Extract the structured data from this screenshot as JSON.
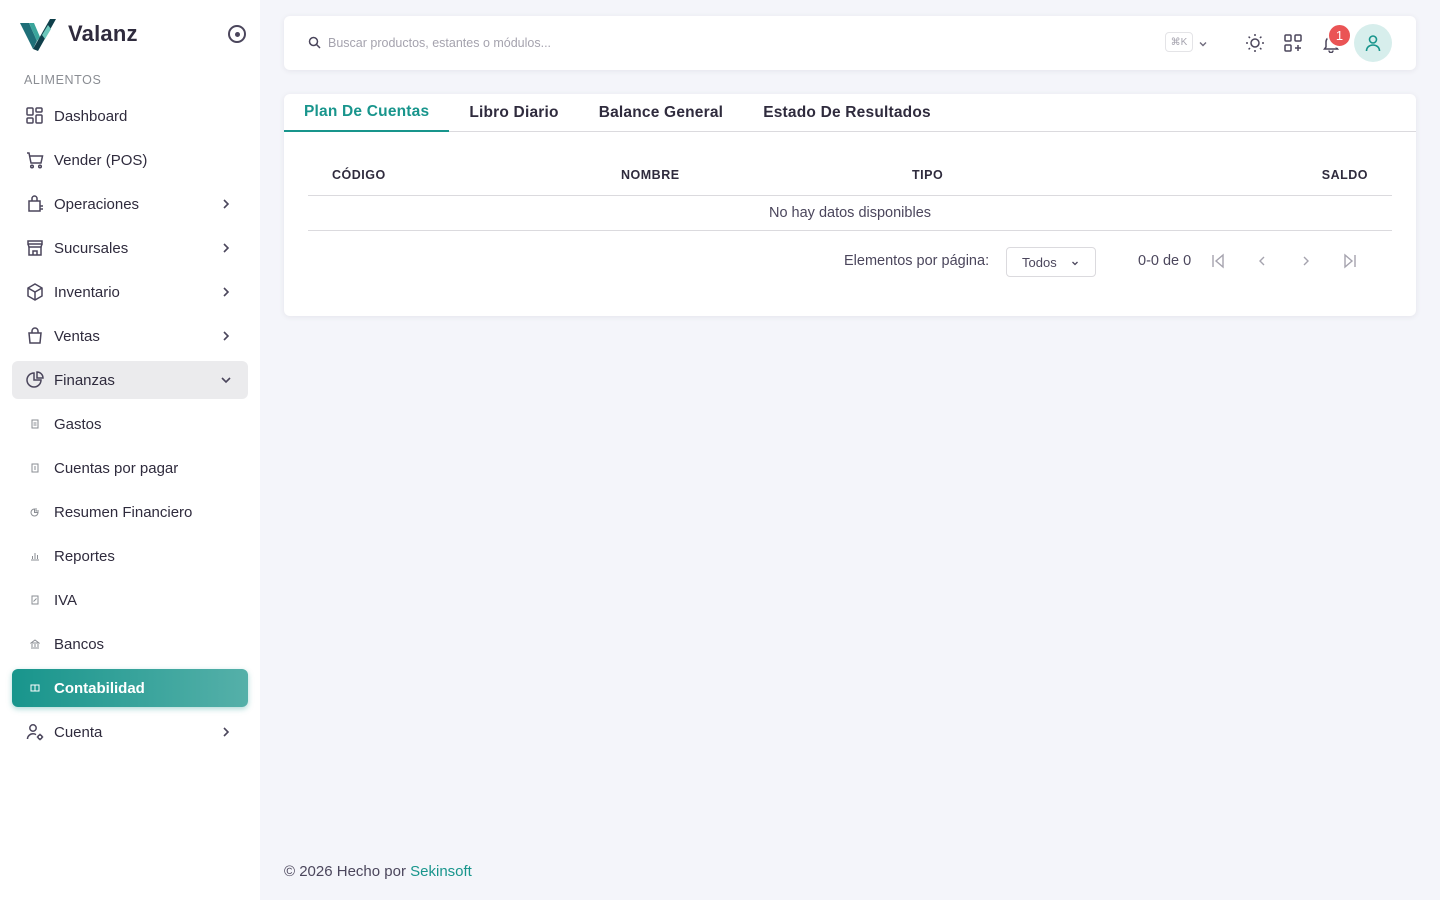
{
  "brand": {
    "name": "Valanz",
    "accent": "#18958c"
  },
  "sidebar": {
    "section": "ALIMENTOS",
    "items": [
      {
        "label": "Dashboard",
        "icon": "dashboard-icon"
      },
      {
        "label": "Vender (POS)",
        "icon": "cart-icon"
      },
      {
        "label": "Operaciones",
        "icon": "operations-icon"
      },
      {
        "label": "Sucursales",
        "icon": "store-icon"
      },
      {
        "label": "Inventario",
        "icon": "box-icon"
      },
      {
        "label": "Ventas",
        "icon": "shopping-bag-icon"
      },
      {
        "label": "Finanzas",
        "icon": "pie-chart-icon"
      },
      {
        "label": "Gastos",
        "icon": "receipt-icon"
      },
      {
        "label": "Cuentas por pagar",
        "icon": "receipt-icon"
      },
      {
        "label": "Resumen Financiero",
        "icon": "pie-chart-icon"
      },
      {
        "label": "Reportes",
        "icon": "bar-chart-icon"
      },
      {
        "label": "IVA",
        "icon": "receipt-tax-icon"
      },
      {
        "label": "Bancos",
        "icon": "bank-icon"
      },
      {
        "label": "Contabilidad",
        "icon": "book-icon"
      },
      {
        "label": "Cuenta",
        "icon": "user-settings-icon"
      }
    ]
  },
  "navbar": {
    "search_placeholder": "Buscar productos, estantes o módulos...",
    "shortcut": "⌘K",
    "notification_count": "1"
  },
  "tabs": [
    "Plan De Cuentas",
    "Libro Diario",
    "Balance General",
    "Estado De Resultados"
  ],
  "table": {
    "columns": [
      "CÓDIGO",
      "NOMBRE",
      "TIPO",
      "SALDO"
    ],
    "empty_message": "No hay datos disponibles"
  },
  "pagination": {
    "label": "Elementos por página:",
    "selected": "Todos",
    "range": "0-0 de 0"
  },
  "footer": {
    "text": "© 2026 Hecho por ",
    "link": "Sekinsoft"
  }
}
